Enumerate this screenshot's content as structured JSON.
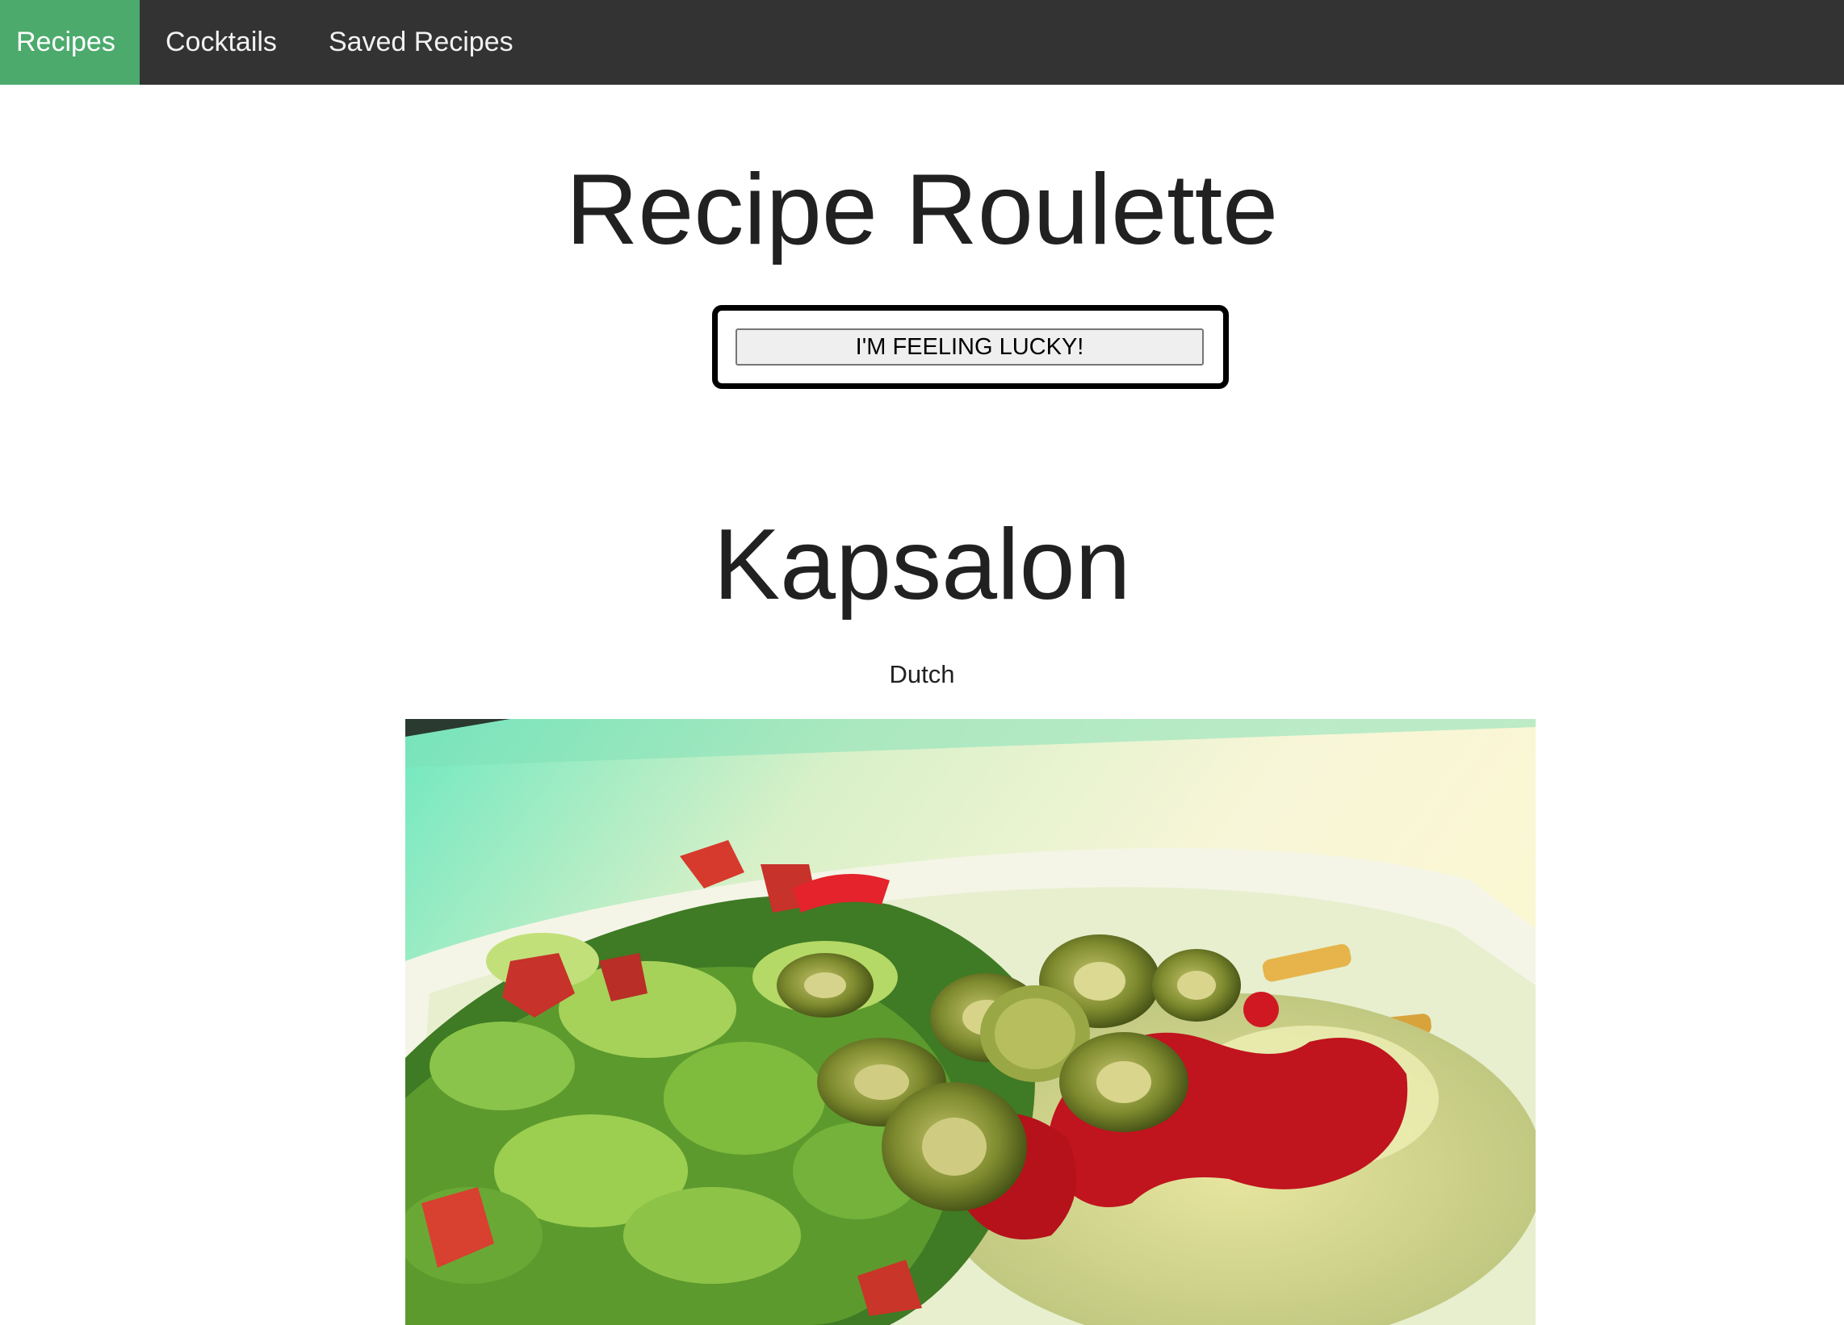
{
  "nav": {
    "items": [
      {
        "label": "Recipes",
        "active": true
      },
      {
        "label": "Cocktails",
        "active": false
      },
      {
        "label": "Saved Recipes",
        "active": false
      }
    ]
  },
  "header": {
    "title": "Recipe Roulette",
    "lucky_button_label": "I'M FEELING LUCKY!"
  },
  "recipe": {
    "name": "Kapsalon",
    "cuisine": "Dutch",
    "image_alt": "Kapsalon"
  },
  "colors": {
    "nav_bg": "#333333",
    "nav_active": "#4CAA6D",
    "text": "#212121"
  }
}
